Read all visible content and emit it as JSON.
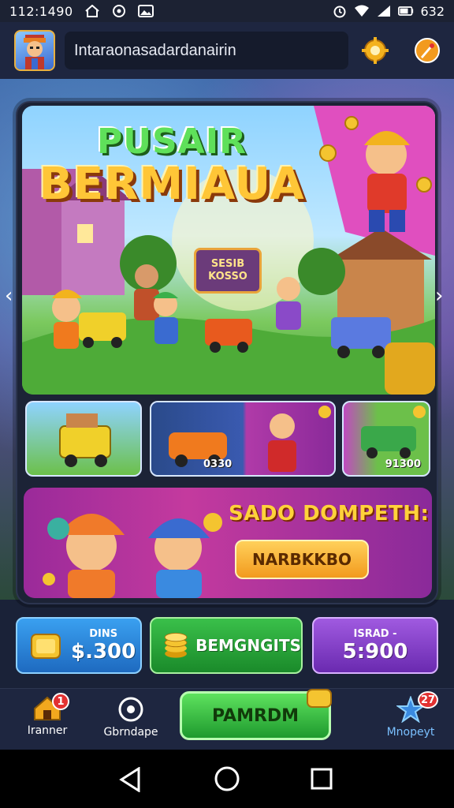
{
  "status_bar": {
    "time": "112:1490",
    "battery": "632"
  },
  "header": {
    "search_value": "Intaraonasadardanairin"
  },
  "hero": {
    "title_line1": "PUSAIR",
    "title_line2": "BERMIAUA",
    "sign_top": "SESIB",
    "sign_bottom": "KOSSO"
  },
  "thumbnails": [
    {
      "label": ""
    },
    {
      "label": "0330"
    },
    {
      "label": "91300"
    }
  ],
  "promo": {
    "title": "SADO DOMPETH:",
    "button_label": "NARBKKBO"
  },
  "stats": [
    {
      "small": "DINS",
      "amount": "$.300"
    },
    {
      "small": "",
      "amount": "BEMGNGITS"
    },
    {
      "small": "ISRAD -",
      "amount": "5:900"
    }
  ],
  "bottom_nav": {
    "home_label": "Iranner",
    "home_badge": "1",
    "discover_label": "Gbrndape",
    "play_label": "PAMRDM",
    "profile_label": "Mnopeyt",
    "profile_badge": "27"
  },
  "colors": {
    "accent_green": "#2fbf3a",
    "accent_orange": "#f29a1e",
    "stat_blue": "#2a8ee0",
    "stat_green": "#2aa33a",
    "stat_purple": "#8a4ac8"
  }
}
